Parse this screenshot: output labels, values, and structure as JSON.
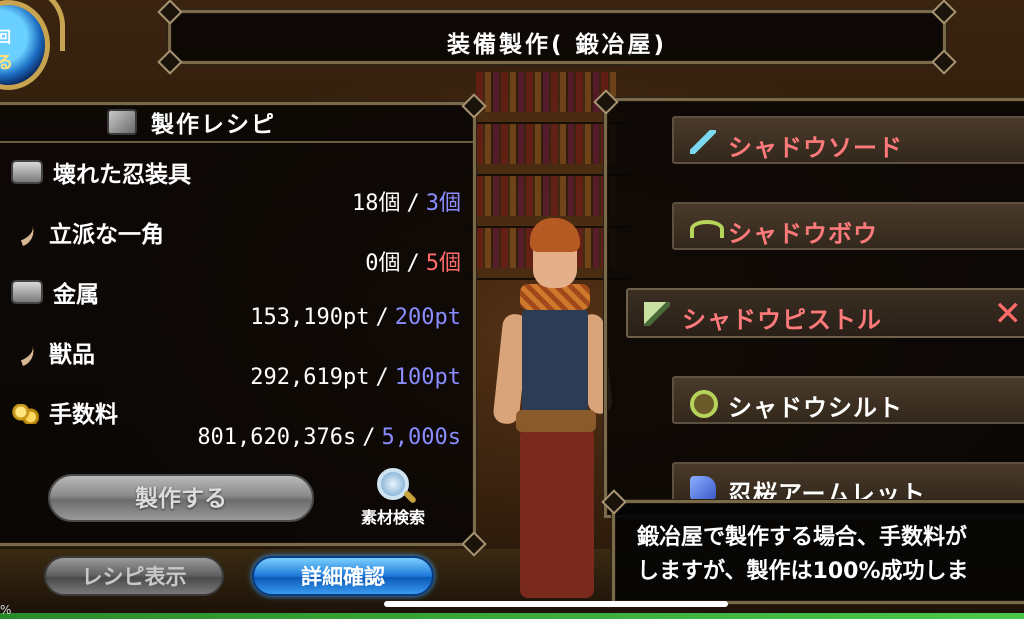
{
  "title": "装備製作( 鍛冶屋)",
  "orb": {
    "label_top": "回",
    "label_bottom": "る"
  },
  "recipe_panel": {
    "heading": "製作レシピ",
    "materials": [
      {
        "name": "壊れた忍装具",
        "icon": "box-icon",
        "have": "18個",
        "need": "3個",
        "status": "sufficient"
      },
      {
        "name": "立派な一角",
        "icon": "horn-icon",
        "have": "0個",
        "need": "5個",
        "status": "insufficient"
      },
      {
        "name": "金属",
        "icon": "box-icon",
        "have": "153,190pt",
        "need": "200pt",
        "status": "sufficient"
      },
      {
        "name": "獣品",
        "icon": "horn-icon",
        "have": "292,619pt",
        "need": "100pt",
        "status": "sufficient"
      },
      {
        "name": "手数料",
        "icon": "coin-icon",
        "have": "801,620,376s",
        "need": "5,000s",
        "status": "sufficient"
      }
    ],
    "separator": "/",
    "craft_button": "製作する",
    "search_label": "素材検索"
  },
  "buttons": {
    "recipe_view": "レシピ表示",
    "detail_check": "詳細確認"
  },
  "item_list": [
    {
      "name": "シャドウソード",
      "icon": "sword-icon",
      "color": "#ff7a7a"
    },
    {
      "name": "シャドウボウ",
      "icon": "bow-icon",
      "color": "#ff7a7a"
    },
    {
      "name": "シャドウピストル",
      "icon": "pistol-icon",
      "color": "#ff7a7a",
      "selected": true,
      "close": "✕"
    },
    {
      "name": "シャドウシルト",
      "icon": "shield-icon",
      "color": "#ffffff"
    },
    {
      "name": "忍桜アームレット",
      "icon": "armlet-icon",
      "color": "#ffffff"
    }
  ],
  "tooltip": {
    "line1": "鍛冶屋で製作する場合、手数料が",
    "line2": "しますが、製作は100%成功しま"
  },
  "progress": {
    "label": "%",
    "value_percent": 100
  },
  "colors": {
    "sufficient": "#8a8cff",
    "insufficient": "#ff6a6a",
    "item_red": "#ff7a7a",
    "accent_blue": "#1e78d8"
  }
}
